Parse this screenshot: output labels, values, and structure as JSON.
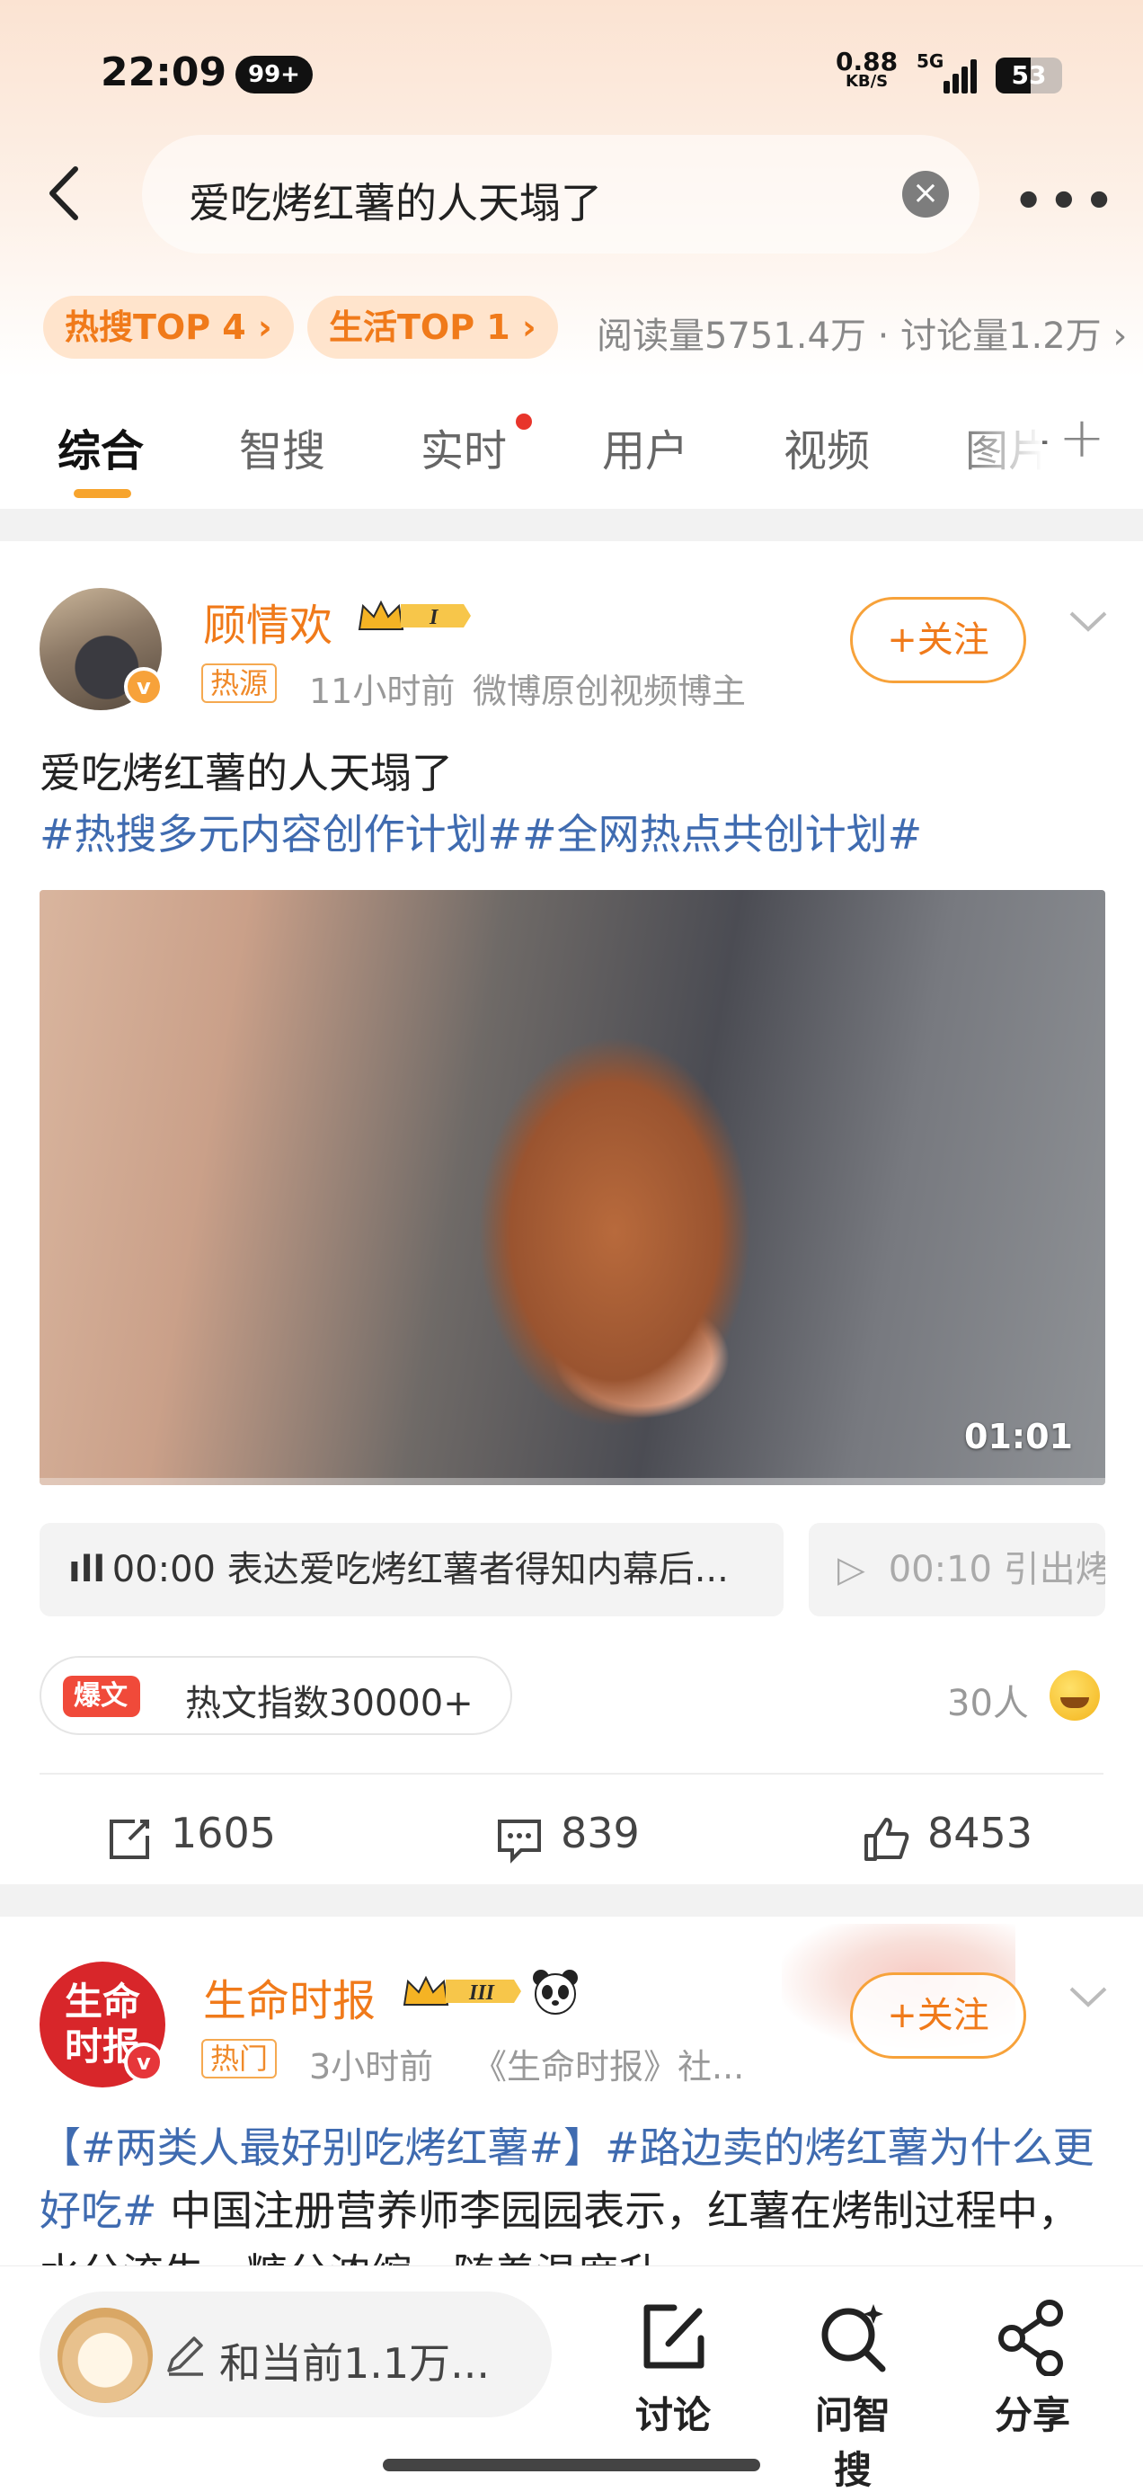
{
  "status_bar": {
    "time": "22:09",
    "notif_badge": "99+",
    "speed": "0.88",
    "speed_unit": "KB/S",
    "network": "5G",
    "battery": "53"
  },
  "search": {
    "query": "爱吃烤红薯的人天塌了"
  },
  "hot_tags": {
    "hot_search": "热搜TOP 4",
    "life": "生活TOP 1",
    "stats": "阅读量5751.4万 · 讨论量1.2万"
  },
  "tabs": [
    {
      "label": "综合"
    },
    {
      "label": "智搜"
    },
    {
      "label": "实时"
    },
    {
      "label": "用户"
    },
    {
      "label": "视频"
    },
    {
      "label": "图片"
    }
  ],
  "post1": {
    "author": "顾情欢",
    "vip_level": "I",
    "tag": "热源",
    "time": "11小时前",
    "desc": "微博原创视频博主",
    "follow": "+关注",
    "title": "爱吃烤红薯的人天塌了",
    "hashtags": "#热搜多元内容创作计划##全网热点共创计划#",
    "video_duration": "01:01",
    "chapter1": "00:00 表达爱吃烤红薯者得知内幕后...",
    "chapter2": "00:10 引出烤",
    "hot_badge_tag": "爆文",
    "hot_badge_text": "热文指数30000+",
    "people": "30人",
    "reposts": "1605",
    "comments": "839",
    "likes": "8453"
  },
  "post2": {
    "author": "生命时报",
    "avatar_text": "生命时报",
    "vip_level": "III",
    "tag": "热门",
    "time": "3小时前",
    "desc": "《生命时报》社...",
    "follow": "+关注",
    "text_hash1": "【#两类人最好别吃烤红薯#】",
    "text_hash2": "#路边卖的烤红薯为什么更好吃#",
    "text_body": " 中国注册营养师李园园表示，红薯在烤制过程中，水分流失，糖分浓缩，随着温度升"
  },
  "bottom_bar": {
    "compose_placeholder": "和当前1.1万...",
    "discuss": "讨论",
    "ask": "问智搜",
    "share": "分享"
  },
  "colors": {
    "accent_orange": "#f07a1a",
    "hashtag_blue": "#3f6bb0",
    "hot_red": "#f04a3a"
  }
}
